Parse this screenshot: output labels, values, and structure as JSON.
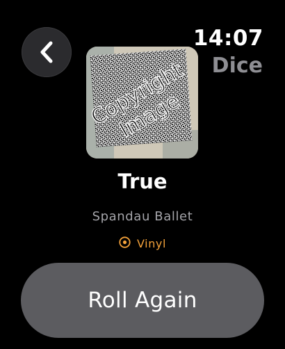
{
  "header": {
    "time": "14:07",
    "app_title": "Dice"
  },
  "album": {
    "watermark_line1": "Copyright",
    "watermark_line2": "Image",
    "title": "True",
    "artist": "Spandau Ballet",
    "format": "Vinyl"
  },
  "actions": {
    "roll_label": "Roll Again"
  },
  "colors": {
    "accent": "#f5a33b",
    "button_bg": "#5c5c60",
    "secondary_text": "#a5a5aa"
  },
  "icons": {
    "back": "chevron-left-icon",
    "format": "vinyl-record-icon"
  }
}
